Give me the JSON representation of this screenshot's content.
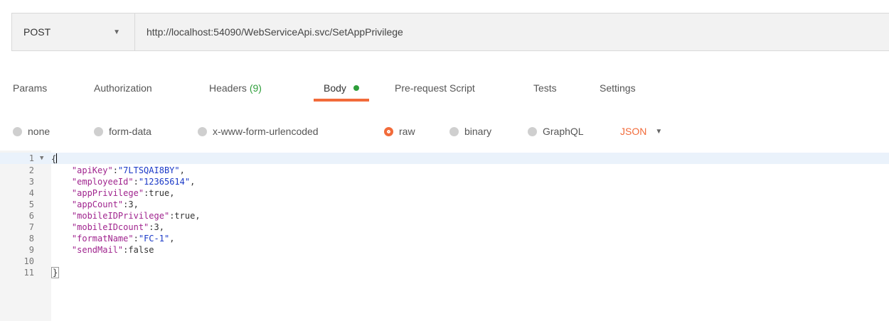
{
  "request": {
    "method": "POST",
    "url": "http://localhost:54090/WebServiceApi.svc/SetAppPrivilege"
  },
  "tabs": [
    {
      "label": "Params"
    },
    {
      "label": "Authorization"
    },
    {
      "label": "Headers",
      "count": "(9)"
    },
    {
      "label": "Body"
    },
    {
      "label": "Pre-request Script"
    },
    {
      "label": "Tests"
    },
    {
      "label": "Settings"
    }
  ],
  "body_types": {
    "options": [
      "none",
      "form-data",
      "x-www-form-urlencoded",
      "raw",
      "binary",
      "GraphQL"
    ],
    "selected": "raw",
    "format": "JSON"
  },
  "editor": {
    "line_numbers": [
      "1",
      "2",
      "3",
      "4",
      "5",
      "6",
      "7",
      "8",
      "9",
      "10",
      "11"
    ],
    "lines": [
      {
        "open": "{"
      },
      {
        "key": "\"apiKey\"",
        "sep": ":",
        "value": "\"7LTSQAI8BY\"",
        "end": ","
      },
      {
        "key": "\"employeeId\"",
        "sep": ":",
        "value": "\"12365614\"",
        "end": ","
      },
      {
        "key": "\"appPrivilege\"",
        "sep": ":",
        "value": "true",
        "end": ","
      },
      {
        "key": "\"appCount\"",
        "sep": ":",
        "value": "3",
        "end": ","
      },
      {
        "key": "\"mobileIDPrivilege\"",
        "sep": ":",
        "value": "true",
        "end": ","
      },
      {
        "key": "\"mobileIDcount\"",
        "sep": ":",
        "value": "3",
        "end": ","
      },
      {
        "key": "\"formatName\"",
        "sep": ":",
        "value": "\"FC-1\"",
        "end": ","
      },
      {
        "key": "\"sendMail\"",
        "sep": ":",
        "value": "false",
        "end": ""
      },
      {},
      {
        "close": "}"
      }
    ]
  },
  "colors": {
    "accent": "#f26b3a",
    "status_green": "#2e9e3a",
    "json_key": "#a0248e",
    "json_string": "#1a39c7"
  }
}
